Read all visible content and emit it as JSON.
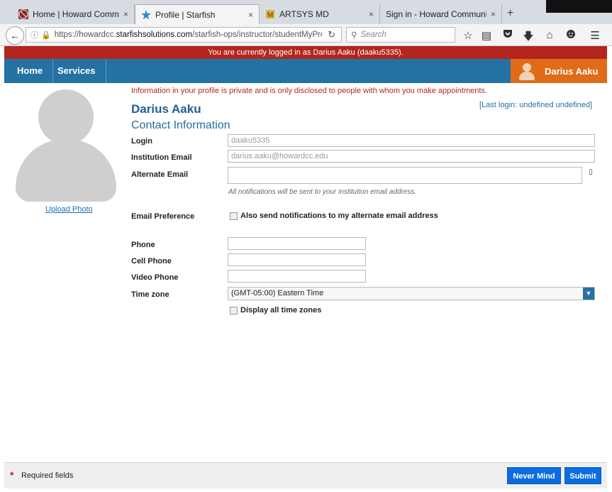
{
  "browser": {
    "tabs": [
      {
        "label": "Home | Howard Communi...",
        "active": false,
        "icon": "blocked-favicon"
      },
      {
        "label": "Profile | Starfish",
        "active": true,
        "icon": "starfish-favicon"
      },
      {
        "label": "ARTSYS MD",
        "active": false,
        "icon": "artsys-favicon"
      },
      {
        "label": "Sign in - Howard Community ...",
        "active": false,
        "icon": "none"
      }
    ],
    "close_glyph": "×",
    "new_tab_glyph": "+",
    "url_prefix": "https://howardcc.",
    "url_domain": "starfishsolutions.com",
    "url_path": "/starfish-ops/instructor/studentMyProfile.h",
    "search_placeholder": "Search"
  },
  "login_banner": "You are currently logged in as Darius Aaku (daaku5335).",
  "app_nav": {
    "home": "Home",
    "services": "Services",
    "user_name": "Darius Aaku"
  },
  "sidebar": {
    "upload_photo": "Upload Photo"
  },
  "profile": {
    "privacy_notice": "Information in your profile is private and is only disclosed to people with whom you make appointments.",
    "last_login": "[Last login: undefined undefined]",
    "name": "Darius Aaku",
    "section_title": "Contact Information",
    "login_label": "Login",
    "login_value": "daaku5335",
    "institution_email_label": "Institution Email",
    "institution_email_value": "darius.aaku@howardcc.edu",
    "alternate_email_label": "Alternate Email",
    "alternate_email_value": "",
    "notification_note": "All notifications will be sent to your institution email address.",
    "email_pref_label": "Email Preference",
    "email_pref_checkbox": "Also send notifications to my alternate email address",
    "phone_label": "Phone",
    "cell_phone_label": "Cell Phone",
    "video_phone_label": "Video Phone",
    "timezone_label": "Time zone",
    "timezone_value": "(GMT-05:00) Eastern Time",
    "display_all_tz": "Display all time zones"
  },
  "footer": {
    "required_star": "*",
    "required_text": "Required fields",
    "never_mind": "Never Mind",
    "submit": "Submit"
  },
  "colors": {
    "banner_red": "#b3261e",
    "nav_blue": "#2471a3",
    "user_orange": "#e06c17",
    "button_blue": "#0a6ce0"
  }
}
